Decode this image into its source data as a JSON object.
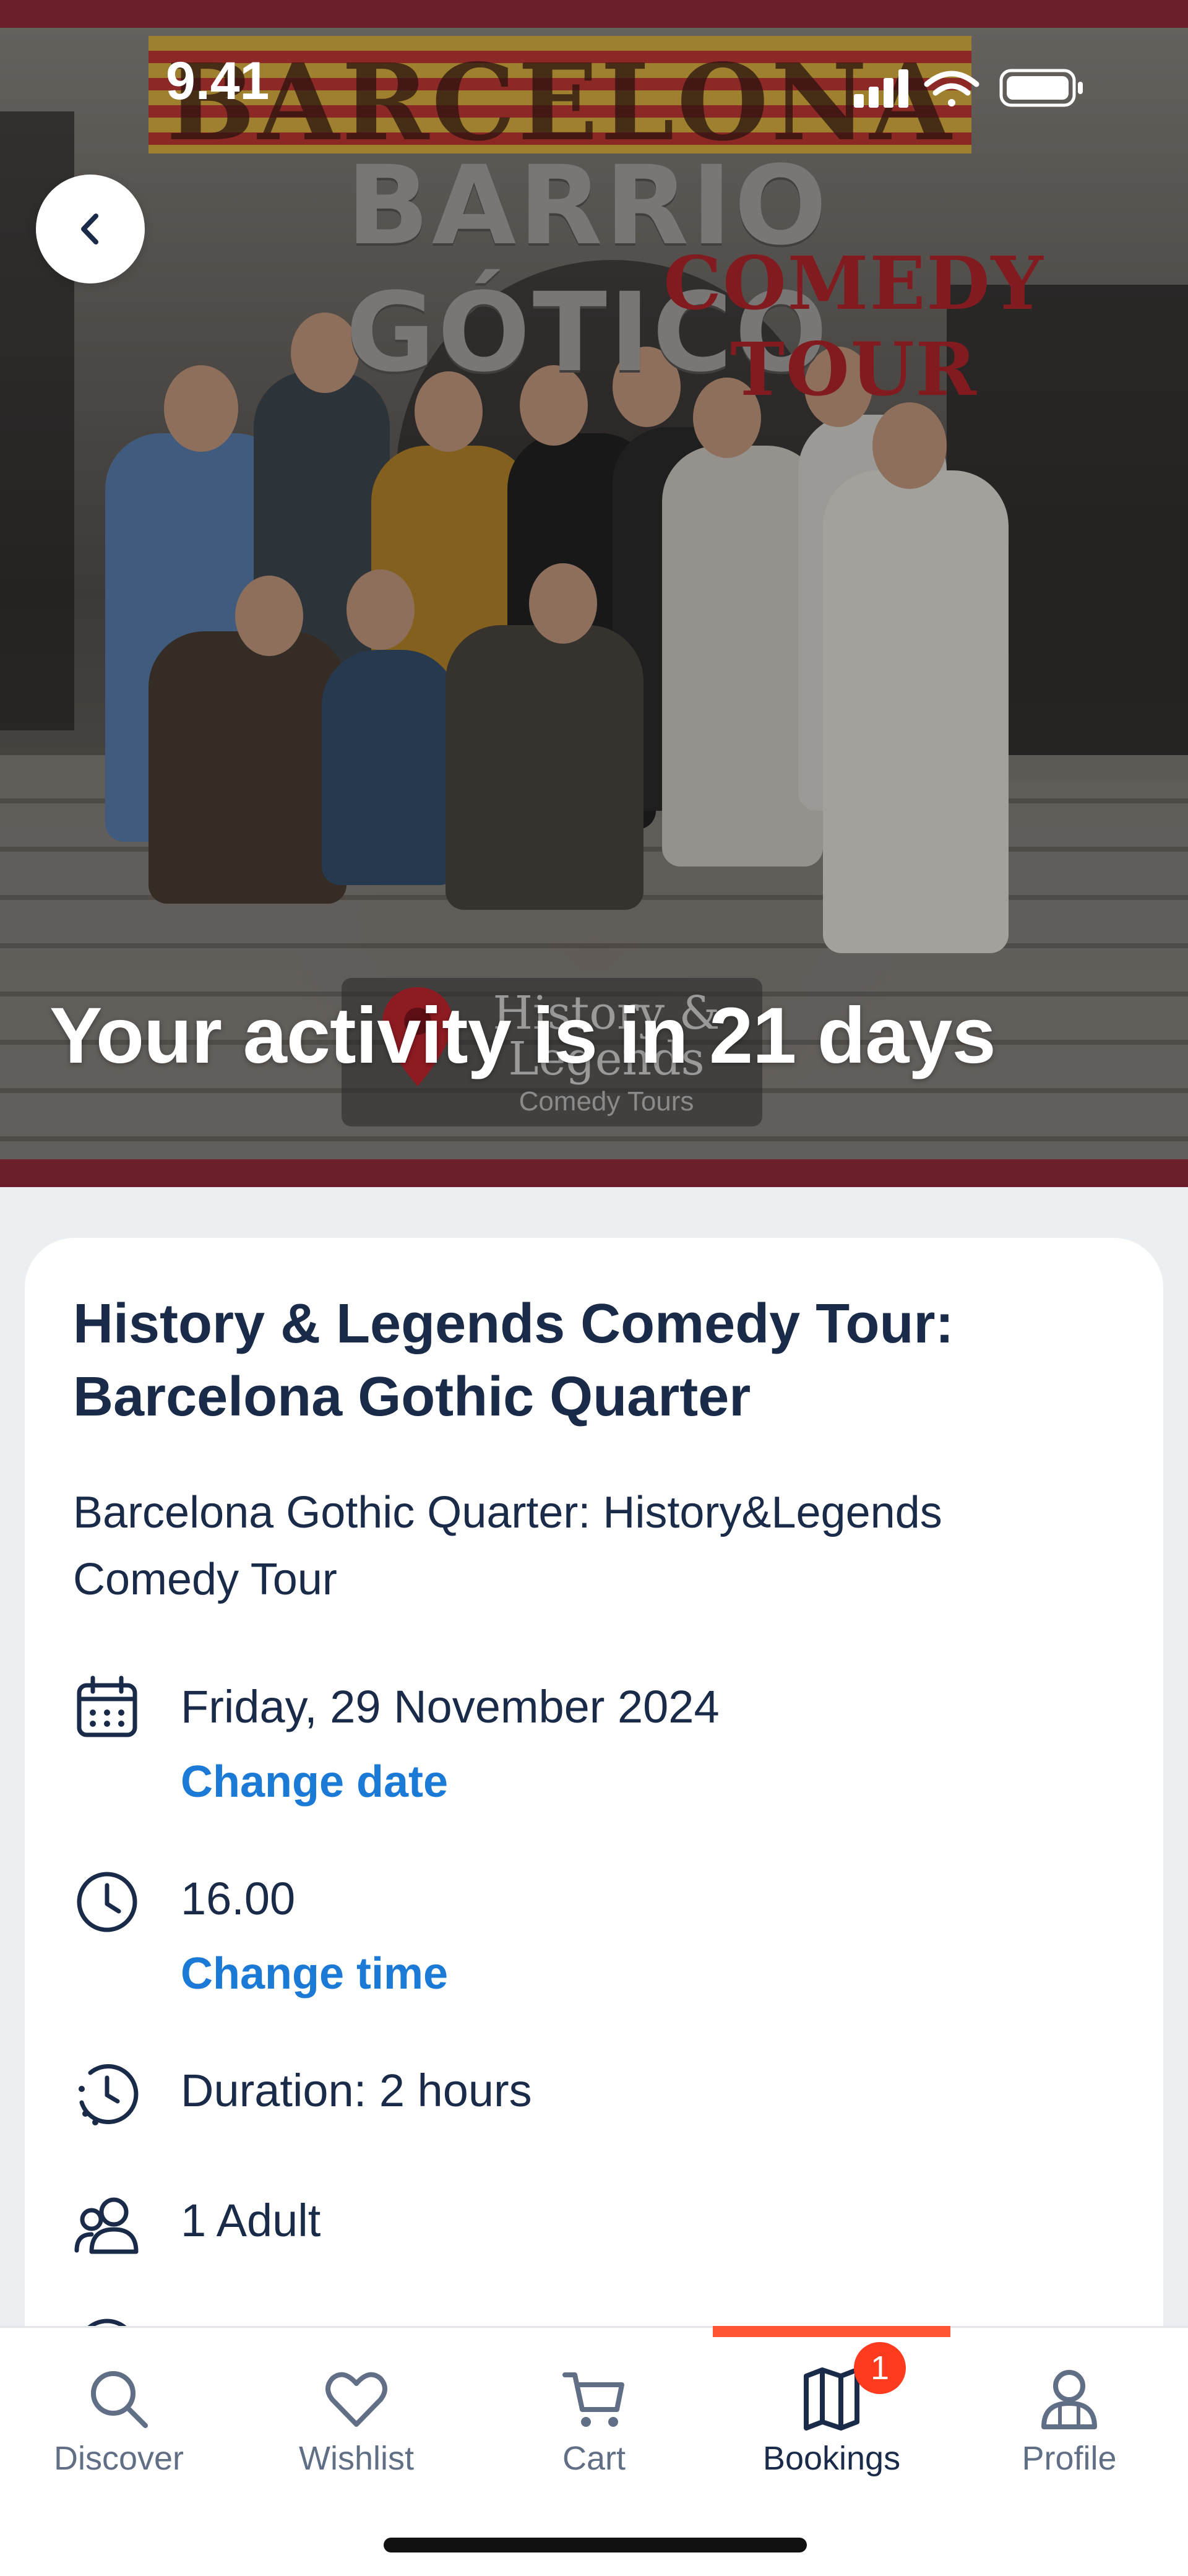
{
  "status_bar": {
    "time": "9.41"
  },
  "hero": {
    "sign_word_1": "BARCELONA",
    "sign_word_2": "BARRIO GÓTICO",
    "sign_word_3": "COMEDY TOUR",
    "logo_title": "History & Legends",
    "logo_sub": "Comedy Tours",
    "countdown": "Your activity is in 21 days",
    "back_icon": "chevron-left-icon"
  },
  "booking": {
    "title": "History & Legends Comedy Tour: Barcelona Gothic Quarter",
    "option": "Barcelona Gothic Quarter: History&Legends Comedy Tour",
    "date": "Friday, 29 November 2024",
    "change_date": "Change date",
    "time": "16.00",
    "change_time": "Change time",
    "duration": "Duration: 2 hours",
    "participants": "1 Adult"
  },
  "tabbar": {
    "active_index": 3,
    "badge_count": "1",
    "items": [
      {
        "label": "Discover",
        "icon": "search-icon"
      },
      {
        "label": "Wishlist",
        "icon": "heart-icon"
      },
      {
        "label": "Cart",
        "icon": "cart-icon"
      },
      {
        "label": "Bookings",
        "icon": "bookmark-map-icon"
      },
      {
        "label": "Profile",
        "icon": "profile-icon"
      }
    ]
  },
  "colors": {
    "link": "#1a7ad6",
    "text": "#1a2b49",
    "accent": "#ff5533",
    "badge": "#ff3b1f",
    "hero_frame": "#6a1f2b"
  }
}
